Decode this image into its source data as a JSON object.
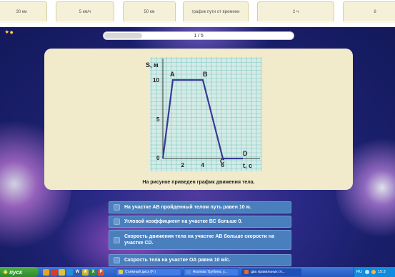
{
  "top_cards": [
    "30 км",
    "5 км/ч",
    "50 км",
    "график пути от времени",
    "2 ч",
    "8"
  ],
  "app": {
    "progress": {
      "label": "1 / 5",
      "fraction": 0.2
    },
    "question": {
      "text": "На рисунке приведен график движения тела.",
      "graph": {
        "y_label": "S, м",
        "x_label": "t, c",
        "y_ticks": [
          "0",
          "5",
          "10"
        ],
        "x_ticks": [
          "2",
          "4",
          "6"
        ],
        "point_labels": [
          "A",
          "B",
          "C",
          "D"
        ],
        "points": [
          [
            0,
            0
          ],
          [
            1,
            10
          ],
          [
            4,
            10
          ],
          [
            6,
            0
          ],
          [
            8,
            0
          ]
        ],
        "xlim": [
          0,
          9
        ],
        "ylim": [
          0,
          13
        ]
      }
    },
    "options": [
      "На участке АВ пройденный телом путь равен 10 м.",
      "Угловой коэффициент на участке ВС больше 0.",
      "Скорость движения тела на участке АВ больше скорости на участке CD.",
      "Скорость тела на участке ОА равна 10 м/с."
    ]
  },
  "taskbar": {
    "start_label": "пуск",
    "tasks": [
      "Съемный диск (F:)",
      "Агапова Трубина, у...",
      "два правильных от..."
    ],
    "tray_lang": "RU",
    "clock": "15:3"
  },
  "colors": {
    "card_bg": "#f1eacb",
    "grid": "#7fc7c2",
    "graph_bg": "#d5ebe6",
    "line": "#3a3a8f",
    "option_bg": "#4a7fbd"
  }
}
